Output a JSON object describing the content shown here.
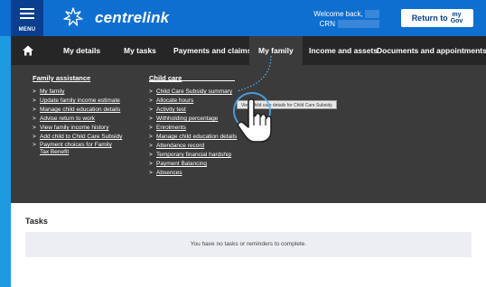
{
  "header": {
    "menu_label": "MENU",
    "brand": "centrelink",
    "welcome_text": "Welcome back,",
    "crn_label": "CRN",
    "return_label": "Return to",
    "mygov_top": "my",
    "mygov_bottom": "Gov"
  },
  "nav": {
    "items": [
      {
        "label": "My details"
      },
      {
        "label": "My tasks"
      },
      {
        "label": "Payments and claims"
      },
      {
        "label": "My family"
      },
      {
        "label": "Income and assets"
      },
      {
        "label": "Documents and appointments"
      }
    ]
  },
  "dropdown": {
    "family_assistance": {
      "heading": "Family assistance",
      "items": [
        "My family",
        "Update family income estimate",
        "Manage child education details",
        "Advise return to work",
        "View family income history",
        "Add child to Child Care Subsidy",
        "Payment choices for Family Tax Benefit"
      ]
    },
    "child_care": {
      "heading": "Child care",
      "items": [
        "Child Care Subsidy summary",
        "Allocate hours",
        "Activity test",
        "Withholding percentage",
        "Enrolments",
        "Manage child education details",
        "Attendance record",
        "Temporary financial hardship",
        "Payment Balancing",
        "Absences"
      ]
    },
    "tooltip": "View child care details for Child Care Subsidy"
  },
  "tasks": {
    "title": "Tasks",
    "empty_message": "You have no tasks or reminders to complete."
  },
  "colors": {
    "header_blue": "#0f6fd1",
    "menu_navy": "#0a3f8f",
    "nav_dark": "#262626",
    "dropdown_gray": "#3b3b3b",
    "frame_blue": "#1d9be0"
  }
}
